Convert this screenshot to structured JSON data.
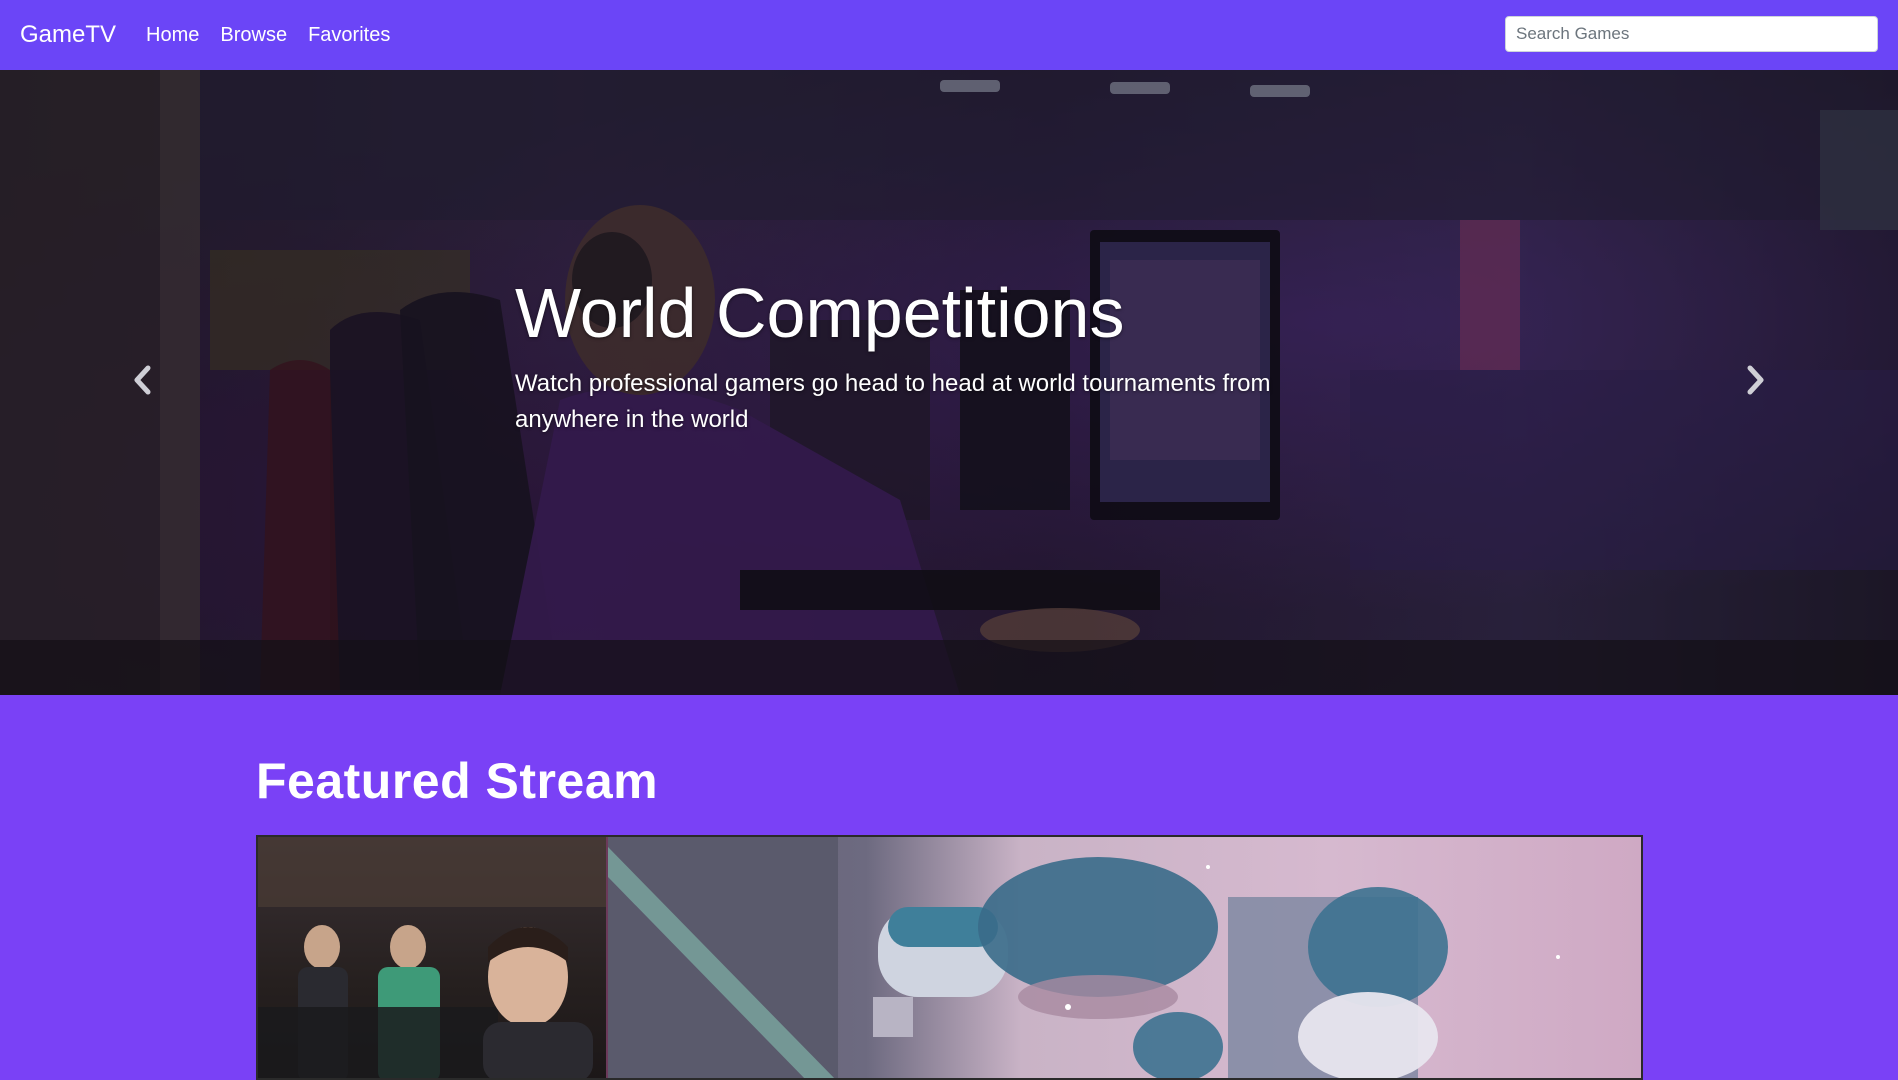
{
  "navbar": {
    "brand": "GameTV",
    "links": [
      {
        "label": "Home"
      },
      {
        "label": "Browse"
      },
      {
        "label": "Favorites"
      }
    ],
    "search": {
      "placeholder": "Search Games",
      "value": ""
    }
  },
  "hero": {
    "title": "World Competitions",
    "text": "Watch professional gamers go head to head at world tournaments from anywhere in the world",
    "prev_icon": "chevron-left-icon",
    "next_icon": "chevron-right-icon"
  },
  "featured": {
    "title": "Featured Stream"
  },
  "colors": {
    "navbar": "#6b45f7",
    "page_background": "#7a41f6",
    "text": "#ffffff"
  }
}
